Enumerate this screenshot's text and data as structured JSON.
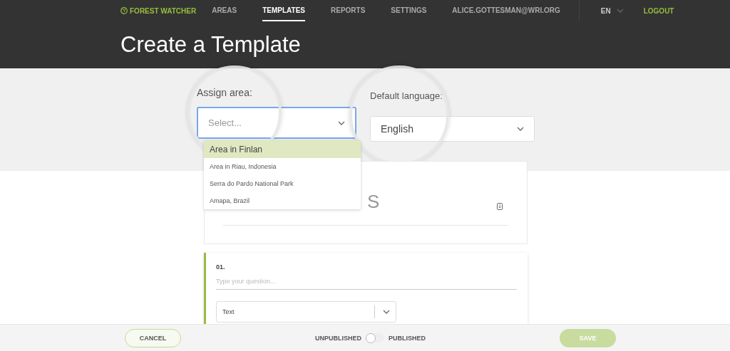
{
  "nav": {
    "brand": "FOREST WATCHER",
    "links": [
      {
        "label": "AREAS",
        "selected": false
      },
      {
        "label": "TEMPLATES",
        "selected": true
      },
      {
        "label": "REPORTS",
        "selected": false
      },
      {
        "label": "SETTINGS",
        "selected": false
      },
      {
        "label": "ALICE.GOTTESMAN@WRI.ORG",
        "selected": false
      }
    ],
    "language": "EN",
    "logout": "LOGOUT"
  },
  "page_title": "Create a Template",
  "area_field": {
    "label": "Assign area:",
    "placeholder": "Select...",
    "focused": true
  },
  "area_dropdown": {
    "options": [
      {
        "label": "Area in Finlan",
        "selected": true
      },
      {
        "label": "Area in Riau, Indonesia",
        "selected": false
      },
      {
        "label": "Serra do Pardo National Park",
        "selected": false
      },
      {
        "label": "Amapa, Brazil",
        "selected": false
      }
    ]
  },
  "language_field": {
    "label": "Default language:",
    "value": "English"
  },
  "template_card": {
    "title_fragment": "S"
  },
  "questions": [
    {
      "number": "01.",
      "placeholder": "Type your question...",
      "type": "Text"
    }
  ],
  "footer": {
    "cancel": "CANCEL",
    "toggle": {
      "off_label": "UNPUBLISHED",
      "on_label": "PUBLISHED",
      "on": false
    },
    "save": {
      "label": "SAVE",
      "disabled": true
    }
  }
}
